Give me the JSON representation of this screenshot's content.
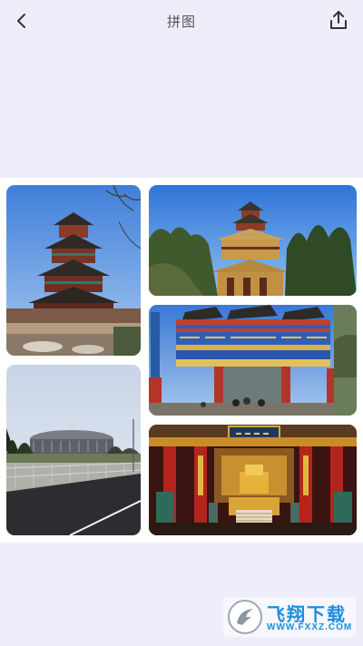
{
  "header": {
    "title": "拼图",
    "back_icon": "chevron-left-icon",
    "share_icon": "share-upload-icon"
  },
  "collage": {
    "tiles": [
      {
        "id": "pagoda-tower",
        "subject": "pagoda"
      },
      {
        "id": "stadium-road",
        "subject": "stadium"
      },
      {
        "id": "temple-hill",
        "subject": "temple"
      },
      {
        "id": "painted-gate",
        "subject": "gate"
      },
      {
        "id": "palace-throne-hall",
        "subject": "throne"
      }
    ]
  },
  "watermark": {
    "brand": "飞翔下载",
    "url": "WWW.FXXZ.COM",
    "color": "#1a8fdc"
  }
}
